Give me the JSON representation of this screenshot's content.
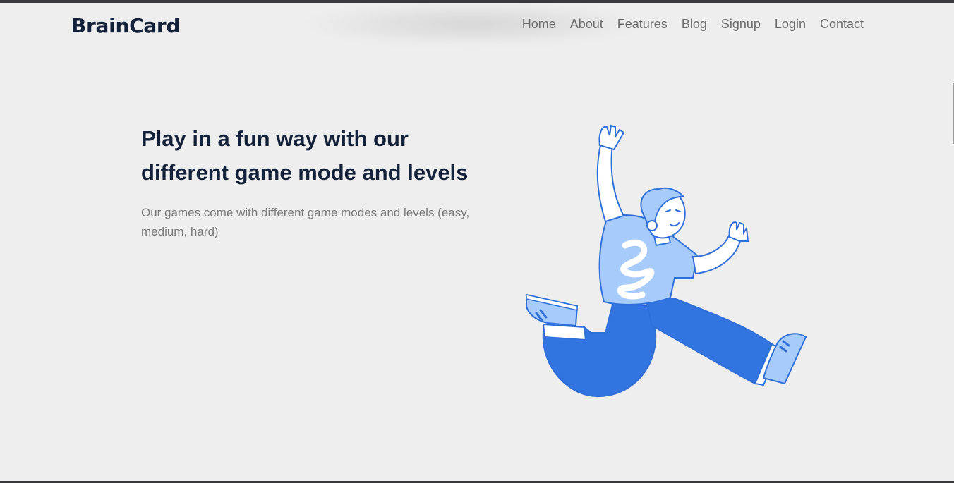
{
  "brand": {
    "name": "BrainCard"
  },
  "nav": {
    "items": [
      {
        "label": "Home"
      },
      {
        "label": "About"
      },
      {
        "label": "Features"
      },
      {
        "label": "Blog"
      },
      {
        "label": "Signup"
      },
      {
        "label": "Login"
      },
      {
        "label": "Contact"
      }
    ]
  },
  "hero": {
    "title_line1": "Play in a fun way with our",
    "title_line2": "different game mode and levels",
    "description": "Our games come with different game modes and levels (easy, medium, hard)",
    "illustration_icon": "jumping-person-illustration"
  },
  "colors": {
    "background": "#eeeeee",
    "heading": "#14213a",
    "nav_text": "#6b6b6b",
    "body_text": "#7a7a7a",
    "illustration_primary": "#3375e0",
    "illustration_light": "#a7cbfa",
    "illustration_outline": "#2f6fd9"
  }
}
